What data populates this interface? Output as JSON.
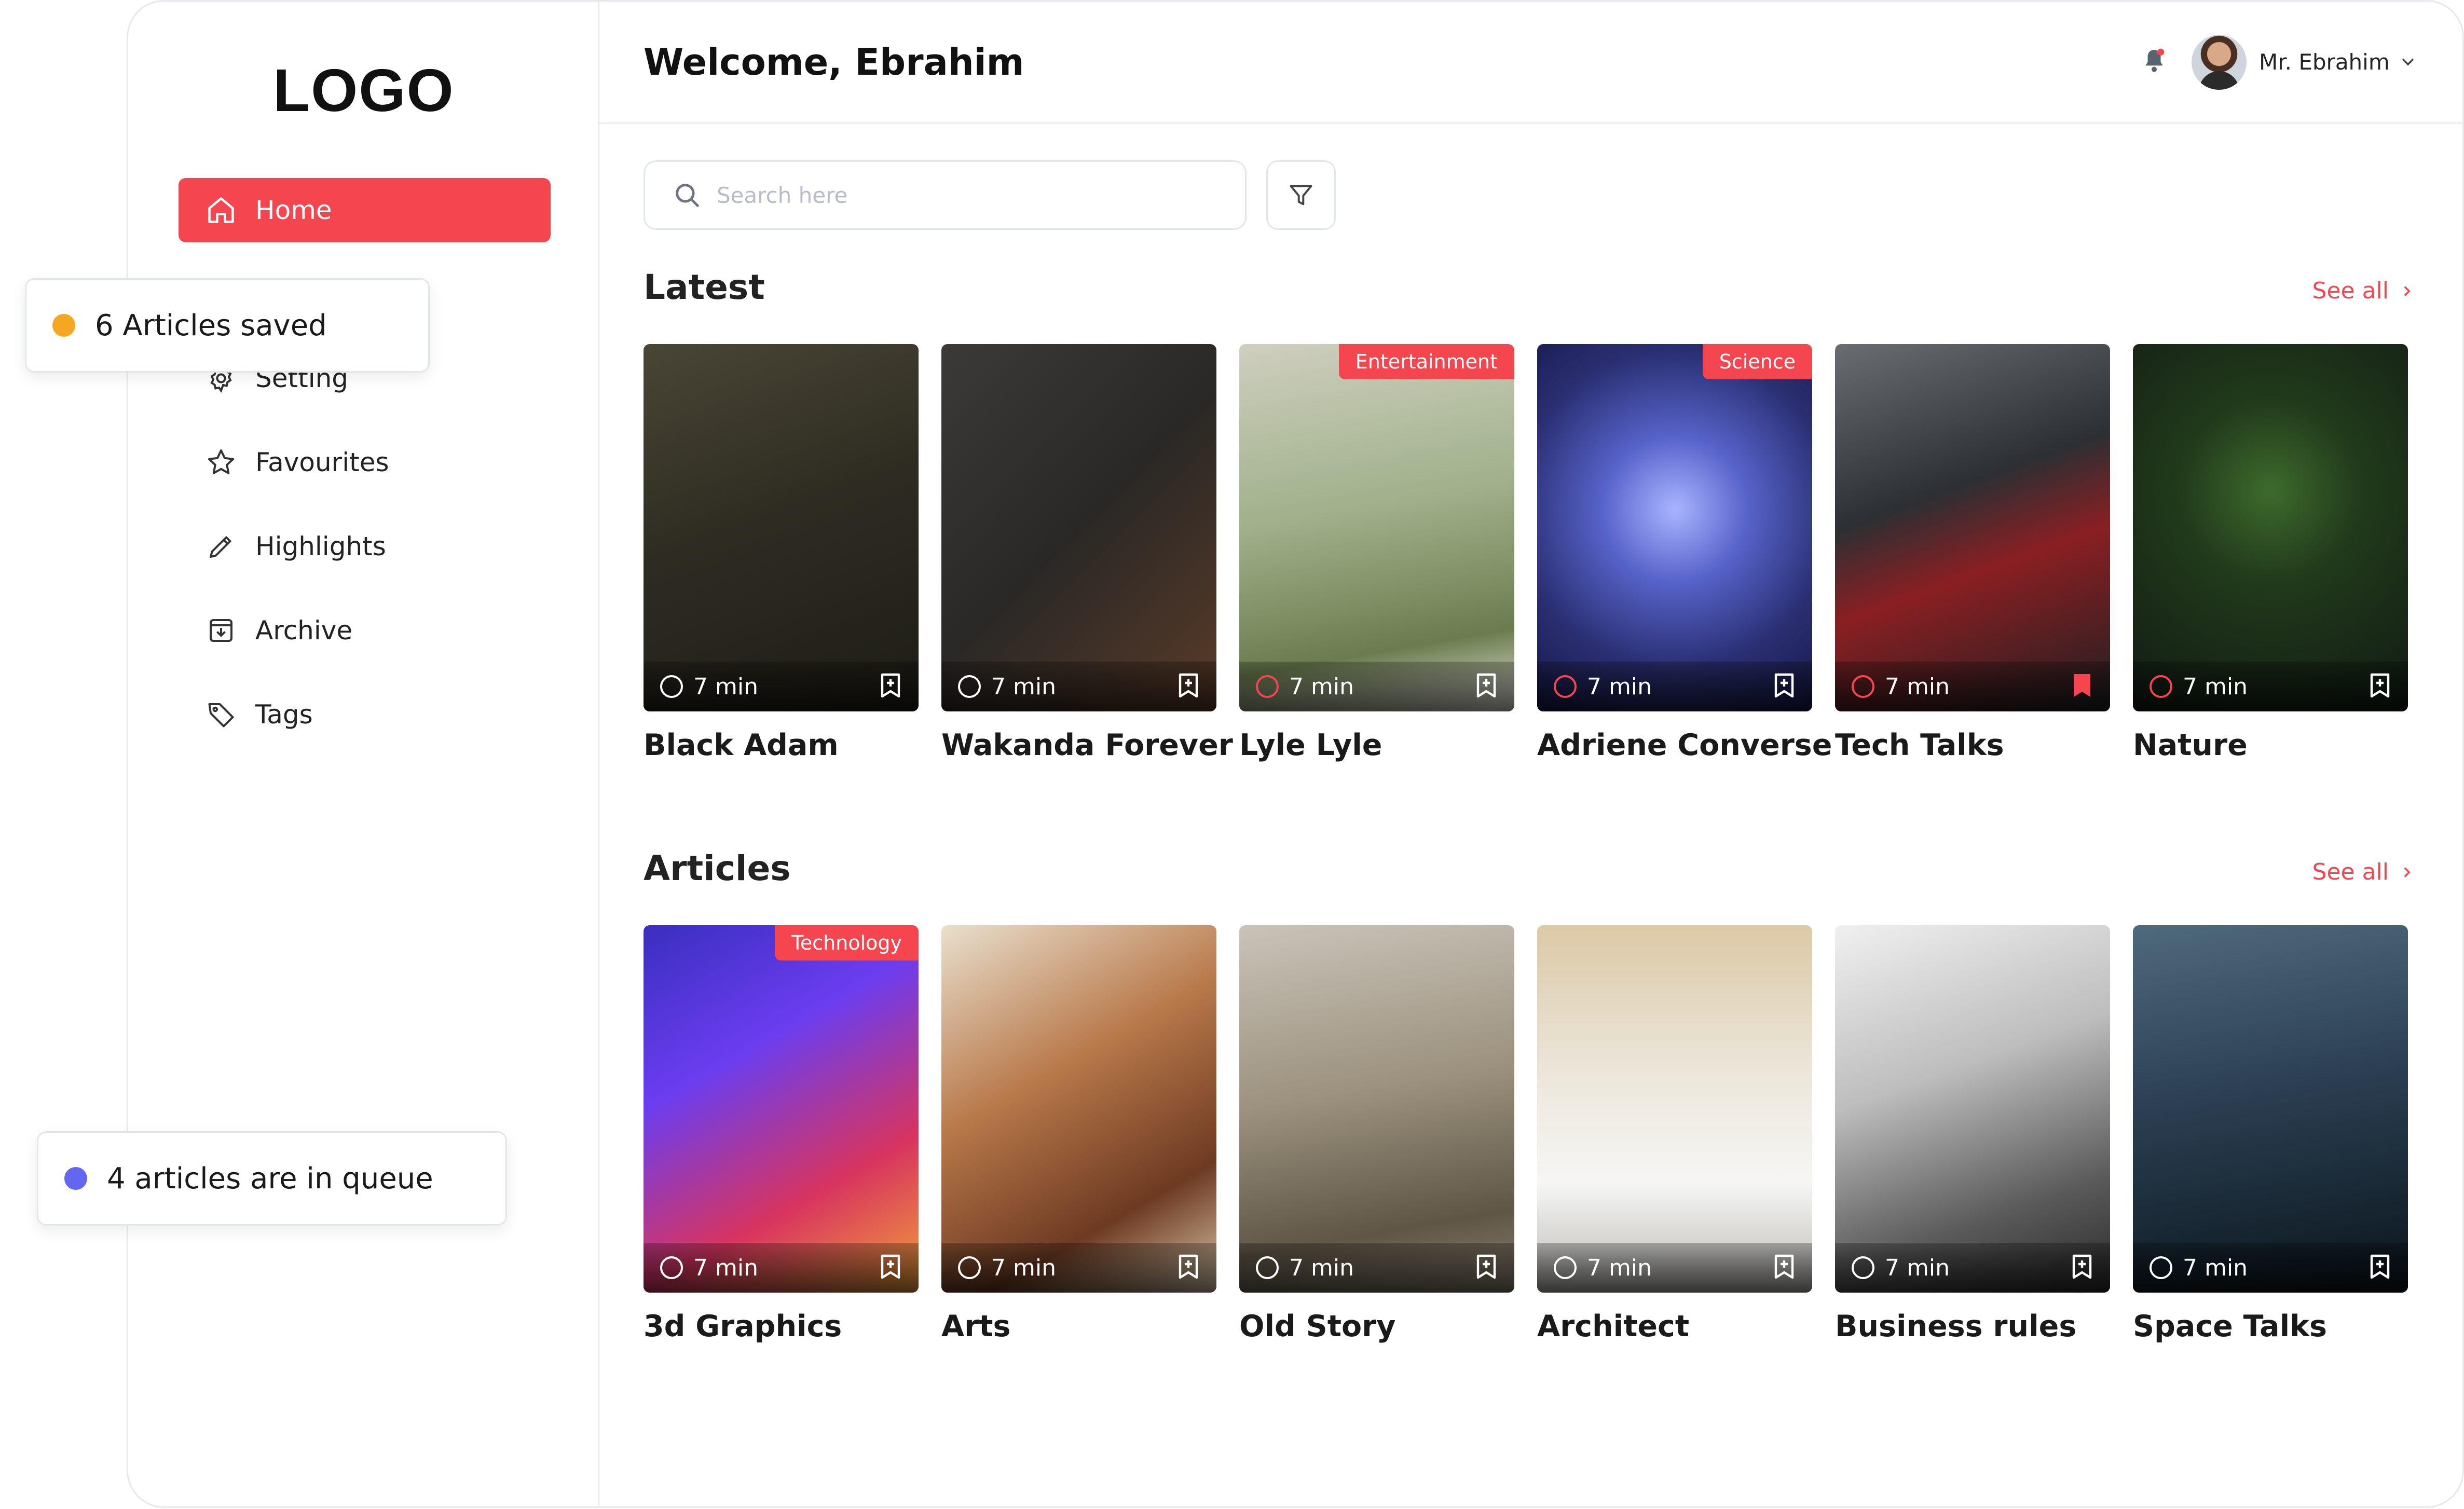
{
  "brand": {
    "logo": "LOGO",
    "accent": "#f5454e"
  },
  "sidebar": {
    "items": [
      {
        "label": "Home",
        "icon": "home-icon",
        "active": true
      },
      {
        "label": "Setting",
        "icon": "gear-icon"
      },
      {
        "label": "Favourites",
        "icon": "star-icon"
      },
      {
        "label": "Highlights",
        "icon": "pen-icon"
      },
      {
        "label": "Archive",
        "icon": "archive-icon"
      },
      {
        "label": "Tags",
        "icon": "tag-icon"
      }
    ]
  },
  "header": {
    "welcome": "Welcome, Ebrahim",
    "user_name": "Mr. Ebrahim",
    "notification_icon": "bell-icon"
  },
  "search": {
    "placeholder": "Search here",
    "value": ""
  },
  "sections": {
    "latest": {
      "title": "Latest",
      "see_all": "See all",
      "cards": [
        {
          "title": "Black Adam",
          "duration": "7 min",
          "tag": "",
          "bookmarked": false
        },
        {
          "title": "Wakanda Forever",
          "duration": "7 min",
          "tag": "",
          "bookmarked": false
        },
        {
          "title": "Lyle Lyle",
          "duration": "7 min",
          "tag": "Entertainment",
          "bookmarked": false
        },
        {
          "title": "Adriene Converse",
          "duration": "7 min",
          "tag": "Science",
          "bookmarked": false
        },
        {
          "title": "Tech Talks",
          "duration": "7 min",
          "tag": "",
          "bookmarked": true
        },
        {
          "title": "Nature",
          "duration": "7 min",
          "tag": "",
          "bookmarked": false
        }
      ]
    },
    "articles": {
      "title": "Articles",
      "see_all": "See all",
      "cards": [
        {
          "title": "3d Graphics",
          "duration": "7 min",
          "tag": "Technology",
          "bookmarked": false
        },
        {
          "title": "Arts",
          "duration": "7 min",
          "tag": "",
          "bookmarked": false
        },
        {
          "title": "Old Story",
          "duration": "7 min",
          "tag": "",
          "bookmarked": false
        },
        {
          "title": "Architect",
          "duration": "7 min",
          "tag": "",
          "bookmarked": false
        },
        {
          "title": "Business rules",
          "duration": "7 min",
          "tag": "",
          "bookmarked": false
        },
        {
          "title": "Space Talks",
          "duration": "7 min",
          "tag": "",
          "bookmarked": false
        }
      ]
    }
  },
  "toasts": {
    "saved": {
      "text": "6 Articles saved",
      "dot_color": "#f5a623"
    },
    "queue": {
      "text": "4 articles are in queue",
      "dot_color": "#6366f1"
    }
  }
}
